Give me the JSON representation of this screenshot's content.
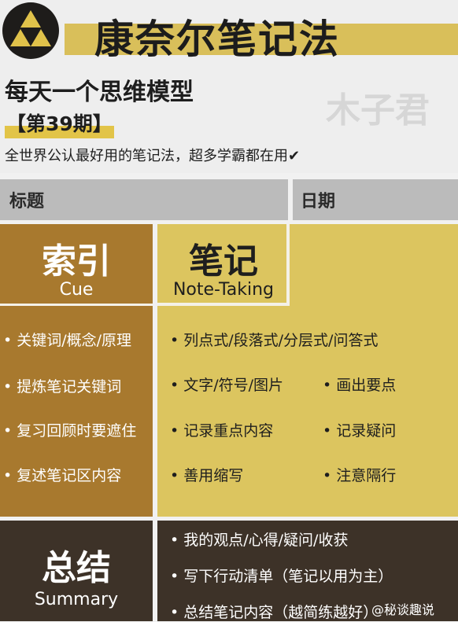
{
  "header": {
    "title": "康奈尔笔记法",
    "subtitle": "每天一个思维模型",
    "issue": "【第39期】",
    "watermark": "木子君",
    "tagline": "全世界公认最好用的笔记法，超多学霸都在用✔"
  },
  "bars": {
    "title_label": "标题",
    "date_label": "日期"
  },
  "cue": {
    "title": "索引",
    "subtitle": "Cue",
    "items": [
      "• 关键词/概念/原理",
      "• 提炼笔记关键词",
      "• 复习回顾时要遮住",
      "• 复述笔记区内容"
    ]
  },
  "notes": {
    "title": "笔记",
    "subtitle": "Note-Taking",
    "items": [
      "• 列点式/段落式/分层式/问答式",
      "• 文字/符号/图片",
      "• 画出要点",
      "• 记录重点内容",
      "• 记录疑问",
      "• 善用缩写",
      "• 注意隔行"
    ]
  },
  "summary": {
    "title": "总结",
    "subtitle": "Summary",
    "items": [
      "• 我的观点/心得/疑问/收获",
      "• 写下行动清单（笔记以用为主）",
      "• 总结笔记内容（越简练越好）"
    ]
  },
  "source": "@秘谈趣说",
  "colors": {
    "cue_brown": "#a8792e",
    "note_yellow": "#dcc55f",
    "summary_dark": "#3d3228",
    "bar_gray": "#bbbbbb"
  },
  "icons": [
    "triangle-logo-icon",
    "weibo-icon"
  ]
}
